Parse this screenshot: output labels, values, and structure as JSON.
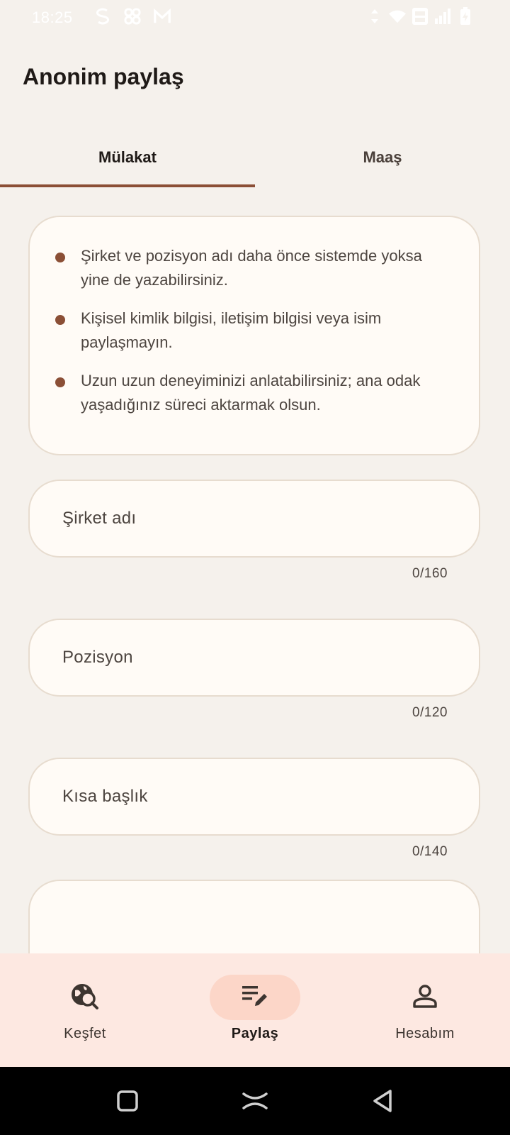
{
  "status_bar": {
    "time": "18:25"
  },
  "page": {
    "title": "Anonim paylaş"
  },
  "tabs": [
    {
      "label": "Mülakat",
      "selected": true
    },
    {
      "label": "Maaş",
      "selected": false
    }
  ],
  "info": {
    "bullets": [
      "Şirket ve pozisyon adı daha önce sistemde yoksa yine de yazabilirsiniz.",
      "Kişisel kimlik bilgisi, iletişim bilgisi veya isim paylaşmayın.",
      "Uzun uzun deneyiminizi anlatabilirsiniz; ana odak yaşadığınız süreci aktarmak olsun."
    ]
  },
  "form": {
    "company": {
      "label": "Şirket adı",
      "value": "",
      "counter": "0/160"
    },
    "position": {
      "label": "Pozisyon",
      "value": "",
      "counter": "0/120"
    },
    "title": {
      "label": "Kısa başlık",
      "value": "",
      "counter": "0/140"
    }
  },
  "bottom_nav": {
    "items": [
      {
        "label": "Keşfet",
        "icon": "explore-search-icon"
      },
      {
        "label": "Paylaş",
        "icon": "edit-note-icon",
        "active": true
      },
      {
        "label": "Hesabım",
        "icon": "person-icon"
      }
    ]
  },
  "colors": {
    "accent": "#8b4f36",
    "background": "#f5f1ec",
    "card": "#fffbf6",
    "nav_bg": "#fde8e1",
    "nav_active": "#fcd6c8"
  }
}
